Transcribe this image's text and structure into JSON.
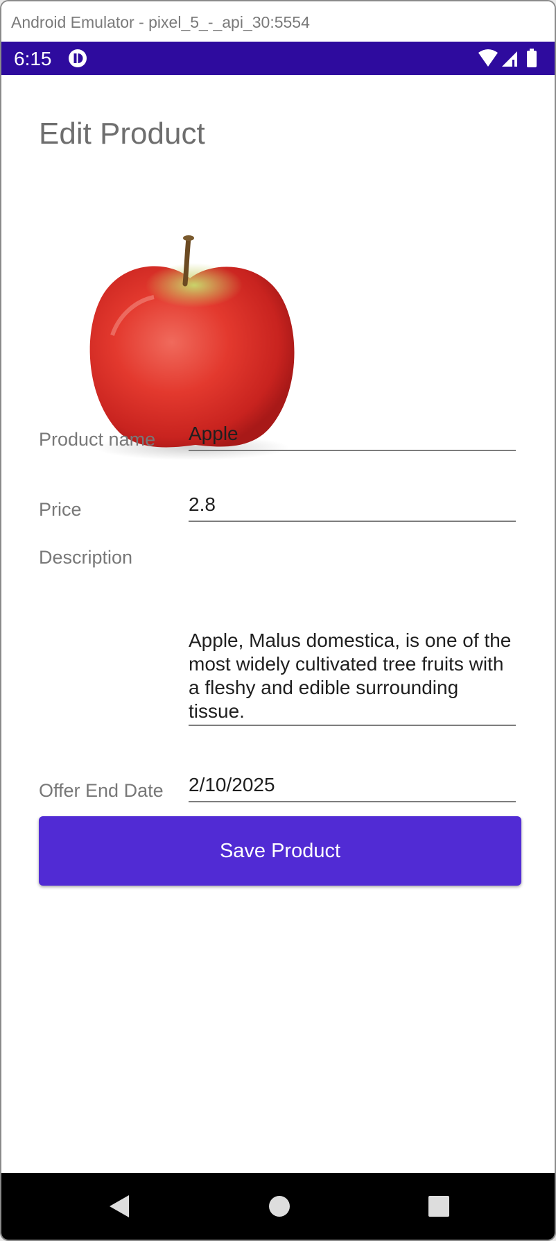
{
  "window": {
    "title": "Android Emulator - pixel_5_-_api_30:5554"
  },
  "status_bar": {
    "time": "6:15",
    "icons": [
      "notification-icon",
      "wifi-icon",
      "signal-icon",
      "battery-icon"
    ],
    "background": "#2e0b9e"
  },
  "page": {
    "title": "Edit Product",
    "image_alt": "apple"
  },
  "form": {
    "product_name": {
      "label": "Product name",
      "value": "Apple"
    },
    "price": {
      "label": "Price",
      "value": "2.8"
    },
    "description": {
      "label": "Description",
      "value": "Apple, Malus domestica, is one of the most widely cultivated tree fruits with a fleshy and edible surrounding tissue."
    },
    "offer_end_date": {
      "label": "Offer End Date",
      "value": "2/10/2025"
    }
  },
  "save_button": {
    "label": "Save Product",
    "color": "#512bd4"
  },
  "nav_bar": {
    "icons": [
      "back-icon",
      "home-icon",
      "recents-icon"
    ]
  }
}
